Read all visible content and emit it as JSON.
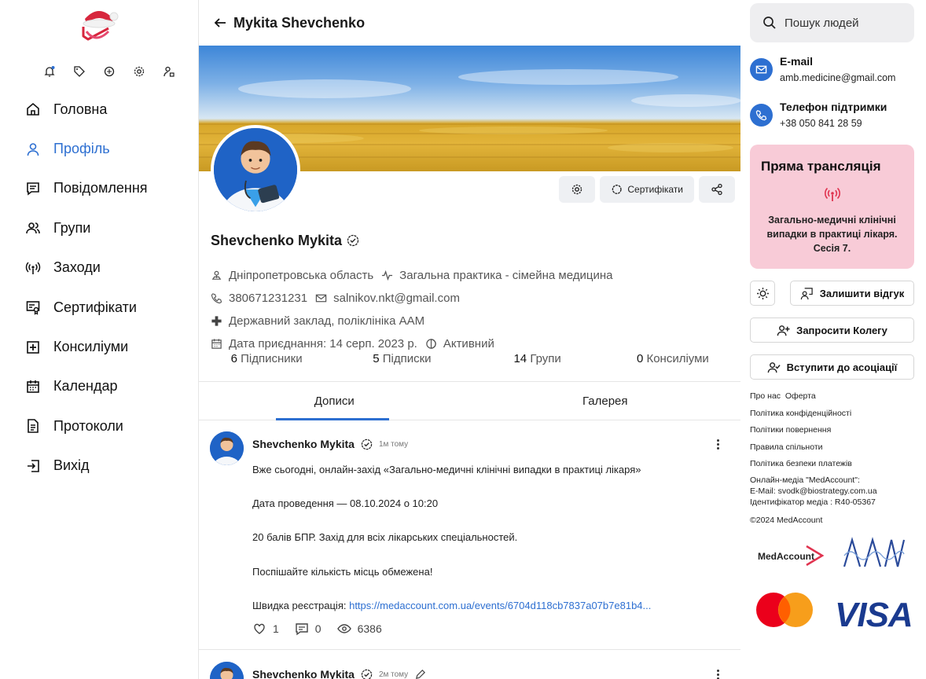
{
  "sidebar": {
    "items": [
      {
        "label": "Головна",
        "icon": "home-icon"
      },
      {
        "label": "Профіль",
        "icon": "user-icon",
        "active": true
      },
      {
        "label": "Повідомлення",
        "icon": "message-icon"
      },
      {
        "label": "Групи",
        "icon": "users-icon"
      },
      {
        "label": "Заходи",
        "icon": "broadcast-icon"
      },
      {
        "label": "Сертифікати",
        "icon": "certificate-icon"
      },
      {
        "label": "Консиліуми",
        "icon": "plus-square-icon"
      },
      {
        "label": "Календар",
        "icon": "calendar-icon"
      },
      {
        "label": "Протоколи",
        "icon": "document-icon"
      },
      {
        "label": "Вихід",
        "icon": "logout-icon"
      }
    ]
  },
  "header": {
    "title": "Mykita Shevchenko"
  },
  "profile": {
    "certificates_label": "Сертифікати",
    "name": "Shevchenko Mykita",
    "region": "Дніпропетровська область",
    "specialty": "Загальна практика - сімейна медицина",
    "phone": "380671231231",
    "email": "salnikov.nkt@gmail.com",
    "workplace": "Державний заклад, поліклініка ААМ",
    "joined": "Дата приєднання: 14 серп. 2023 р.",
    "status": "Активний"
  },
  "stats": [
    {
      "count": "6",
      "label": "Підписники"
    },
    {
      "count": "5",
      "label": "Підписки"
    },
    {
      "count": "14",
      "label": "Групи"
    },
    {
      "count": "0",
      "label": "Консиліуми"
    }
  ],
  "tabs": [
    "Дописи",
    "Галерея"
  ],
  "posts": [
    {
      "author": "Shevchenko Mykita",
      "time": "1м тому",
      "lines": [
        "Вже сьогодні, онлайн-захід «Загально-медичні клінічні випадки в практиці лікаря»",
        "Дата проведення — 08.10.2024 о 10:20",
        "20 балів БПР.  Захід для всіх лікарських спеціальностей.",
        "Поспішайте кількість місць обмежена!"
      ],
      "reg_label": "Швидка реєстрація: ",
      "reg_link": "https://medaccount.com.ua/events/6704d118cb7837a07b7e81b4...",
      "likes": "1",
      "comments": "0",
      "views": "6386"
    },
    {
      "author": "Shevchenko Mykita",
      "time": "2м тому"
    }
  ],
  "right": {
    "search_placeholder": "Пошук людей",
    "email_title": "E-mail",
    "email_value": "amb.medicine@gmail.com",
    "phone_title": "Телефон підтримки",
    "phone_value": "+38 050 841 28 59",
    "live_title": "Пряма трансляція",
    "live_text": "Загально-медичні клінічні випадки в практиці лікаря. Сесія 7.",
    "feedback_label": "Залишити відгук",
    "invite_label": "Запросити Колегу",
    "join_label": "Вступити до асоціації",
    "links": {
      "about": "Про нас",
      "offer": "Оферта",
      "privacy": "Політика конфіденційності",
      "refund": "Політики повернення",
      "community": "Правила спільноти",
      "payment": "Політика безпеки платежів"
    },
    "media_lines": [
      "Онлайн-медіа \"MedAccount\":",
      "E-Mail: svodk@biostrategy.com.ua",
      "Ідентифікатор медіа : R40-05367"
    ],
    "copyright": "©2024 MedAccount",
    "medaccount_logo": "MedAccount",
    "visa": "VISA"
  },
  "colors": {
    "accent": "#2d6fd1",
    "live_bg": "#f8cbd7",
    "mc_red": "#eb001b",
    "mc_orange": "#f79e1b",
    "visa_blue": "#1a3a8f"
  }
}
